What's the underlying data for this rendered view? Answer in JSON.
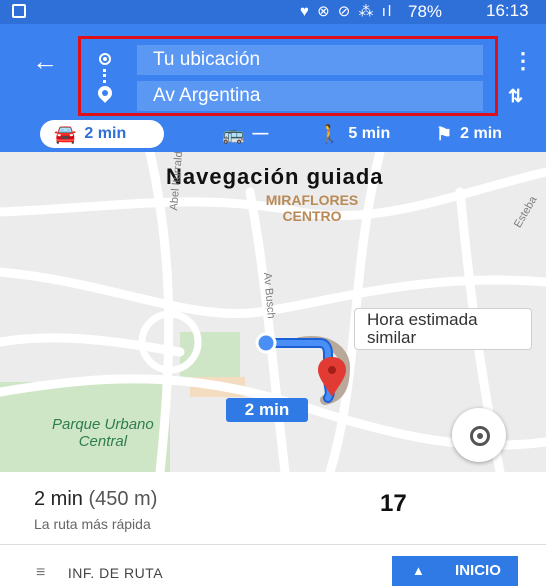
{
  "status_bar": {
    "icons_glyphs": "♥ ⊗ ⊘ ⁂ ıl",
    "battery": "78%",
    "time": "16:13"
  },
  "header": {
    "origin": "Tu ubicación",
    "destination": "Av Argentina",
    "highlight_color": "#e0101a",
    "accent_color": "#3b82f0"
  },
  "modes": {
    "car": "2 min",
    "transit": "—",
    "walk": "5 min",
    "ride": "2 min"
  },
  "map": {
    "title": "Navegación guiada",
    "district_line1": "MIRAFLORES",
    "district_line2": "CENTRO",
    "road_1": "Abel Iturralde",
    "road_2": "Av Busch",
    "road_3": "Esteba",
    "park_line1": "Parque Urbano",
    "park_line2": "Central",
    "eta_line1": "Hora estimada",
    "eta_line2": "similar",
    "route_chip": "2 min"
  },
  "sheet": {
    "time": "2 min",
    "distance": "(450 m)",
    "subtitle": "La ruta más rápida",
    "number": "17",
    "route_info": "INF. DE RUTA",
    "start": "INICIO"
  }
}
